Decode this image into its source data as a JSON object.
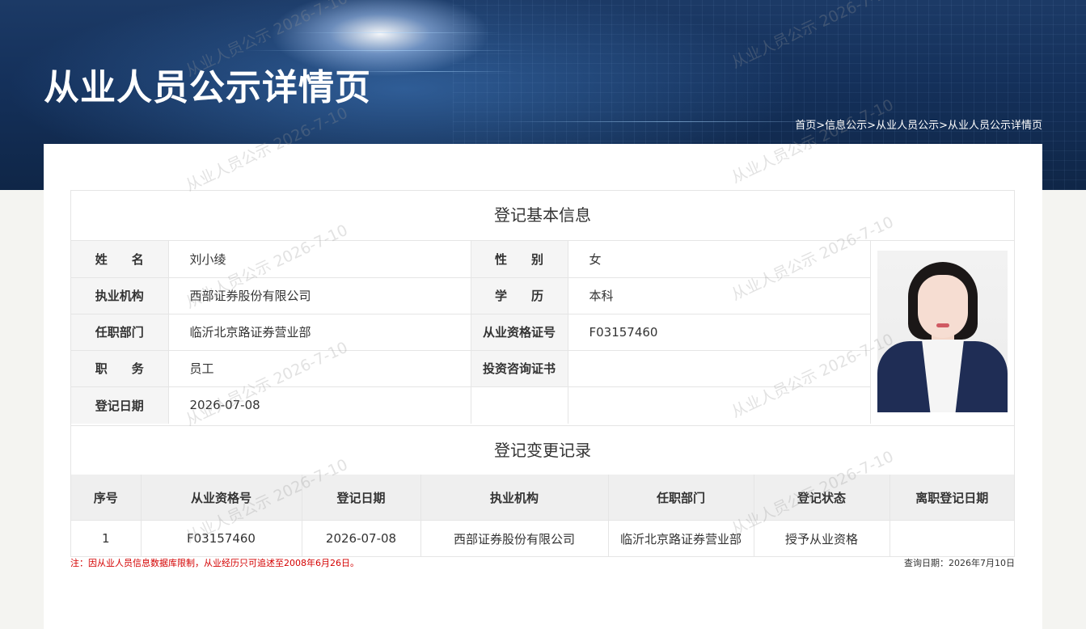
{
  "header": {
    "title": "从业人员公示详情页",
    "breadcrumb": [
      "首页",
      "信息公示",
      "从业人员公示",
      "从业人员公示详情页"
    ],
    "breadcrumb_separator": ">"
  },
  "basic_info": {
    "section_title": "登记基本信息",
    "rows": [
      {
        "label_left": "姓　　名",
        "value_left": "刘小绫",
        "label_right": "性　　别",
        "value_right": "女"
      },
      {
        "label_left": "执业机构",
        "value_left": "西部证券股份有限公司",
        "label_right": "学　　历",
        "value_right": "本科"
      },
      {
        "label_left": "任职部门",
        "value_left": "临沂北京路证券营业部",
        "label_right": "从业资格证号",
        "value_right": "F03157460"
      },
      {
        "label_left": "职　　务",
        "value_left": "员工",
        "label_right": "投资咨询证书",
        "value_right": ""
      },
      {
        "label_left": "登记日期",
        "value_left": "2026-07-08",
        "label_right": "",
        "value_right": ""
      }
    ]
  },
  "change_records": {
    "section_title": "登记变更记录",
    "columns": [
      "序号",
      "从业资格号",
      "登记日期",
      "执业机构",
      "任职部门",
      "登记状态",
      "离职登记日期"
    ],
    "rows": [
      [
        "1",
        "F03157460",
        "2026-07-08",
        "西部证券股份有限公司",
        "临沂北京路证券营业部",
        "授予从业资格",
        ""
      ]
    ]
  },
  "footer": {
    "note": "注：因从业人员信息数据库限制，从业经历只可追述至2008年6月26日。",
    "query_date": "查询日期：2026年7月10日"
  },
  "watermark": {
    "text": "从业人员公示 2026-7-10"
  },
  "colors": {
    "header_bg": "#14305a",
    "note_red": "#d40000",
    "label_bg": "#f5f5f5",
    "table_header_bg": "#efefef"
  }
}
